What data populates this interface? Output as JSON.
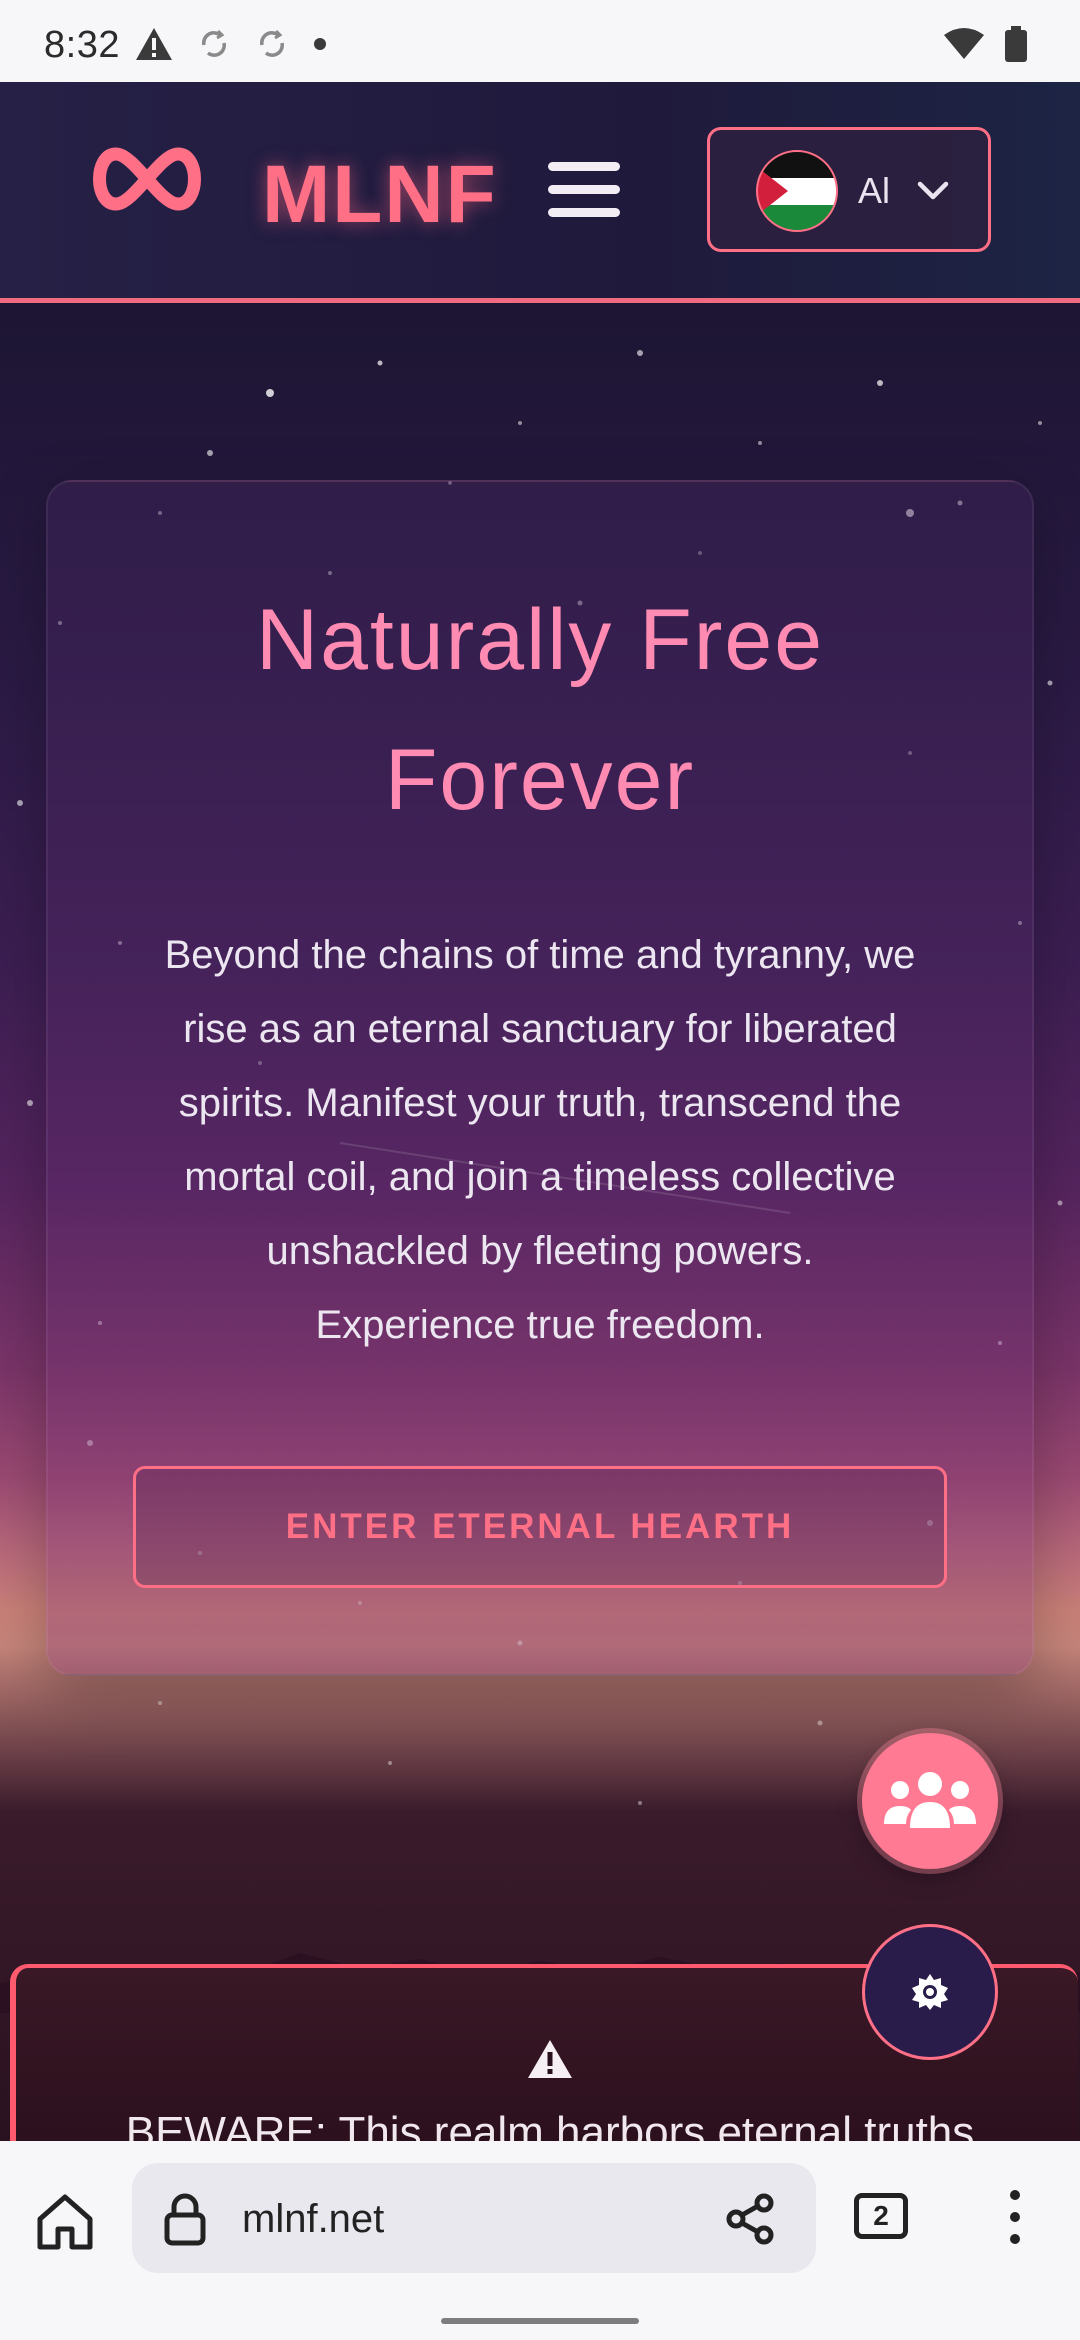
{
  "status_bar": {
    "time": "8:32",
    "icons_left": [
      "warning-icon",
      "sync-off-icon",
      "sync-off-icon",
      "dot-icon"
    ],
    "icons_right": [
      "wifi-icon",
      "battery-icon"
    ]
  },
  "header": {
    "brand": "MLNF",
    "logo_icon": "infinity-icon",
    "menu_icon": "hamburger-icon",
    "language": {
      "label": "Al",
      "flag_icon": "palestine-flag-icon",
      "chevron_icon": "chevron-down-icon"
    }
  },
  "hero": {
    "title_line1": "Naturally Free",
    "title_line2": "Forever",
    "text_lines": [
      "Beyond the chains of time and tyranny, we",
      "rise as an eternal sanctuary for liberated",
      "spirits. Manifest your truth, transcend the",
      "mortal coil, and join a timeless collective",
      "unshackled by fleeting powers.",
      "Experience true freedom."
    ],
    "cta_label": "ENTER ETERNAL HEARTH"
  },
  "floating": {
    "community_icon": "people-group-icon",
    "theme_icon": "sun-icon"
  },
  "warning": {
    "icon": "warning-triangle-icon",
    "text": "BEWARE: This realm harbors eternal truths"
  },
  "browser": {
    "url": "mlnf.net",
    "tab_count": "2",
    "icons": [
      "home-icon",
      "lock-icon",
      "share-icon",
      "tabs-icon",
      "more-vert-icon"
    ]
  },
  "colors": {
    "accent": "#ff6f86",
    "title_pink": "#ff8bb2",
    "header_bg": "#231e42",
    "warning_border": "#ff5a6e"
  }
}
